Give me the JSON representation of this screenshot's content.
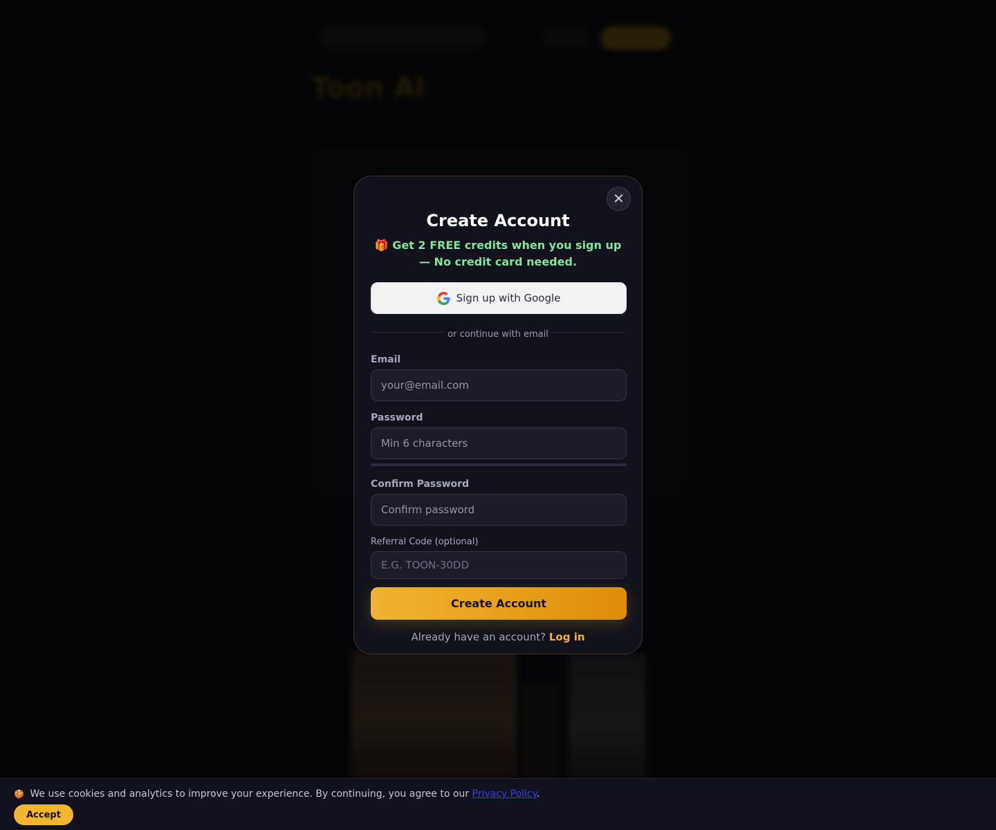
{
  "background": {
    "title": "Toon Al",
    "subtitle": ""
  },
  "modal": {
    "close_symbol": "✕",
    "title": "Create Account",
    "promo_icon": "🎁",
    "promo_text": "Get 2 FREE credits when you sign up — No credit card needed.",
    "google_button_label": "Sign up with Google",
    "divider_text": "or continue with email",
    "email": {
      "label": "Email",
      "placeholder": "your@email.com",
      "value": ""
    },
    "password": {
      "label": "Password",
      "placeholder": "Min 6 characters",
      "value": ""
    },
    "confirm_password": {
      "label": "Confirm Password",
      "placeholder": "Confirm password",
      "value": ""
    },
    "referral": {
      "label": "Referral Code (optional)",
      "placeholder": "E.G. TOON-30DD",
      "value": ""
    },
    "submit_label": "Create Account",
    "login_prompt": "Already have an account?",
    "login_link": "Log in"
  },
  "cookie_banner": {
    "icon": "🍪",
    "text": "We use cookies and analytics to improve your experience. By continuing, you agree to our",
    "link_text": "Privacy Policy",
    "trailing": ".",
    "accept_label": "Accept"
  },
  "colors": {
    "accent": "#f2b52e",
    "promo_green": "#86e39b",
    "modal_bg": "#12121c",
    "page_bg": "#07070a"
  }
}
